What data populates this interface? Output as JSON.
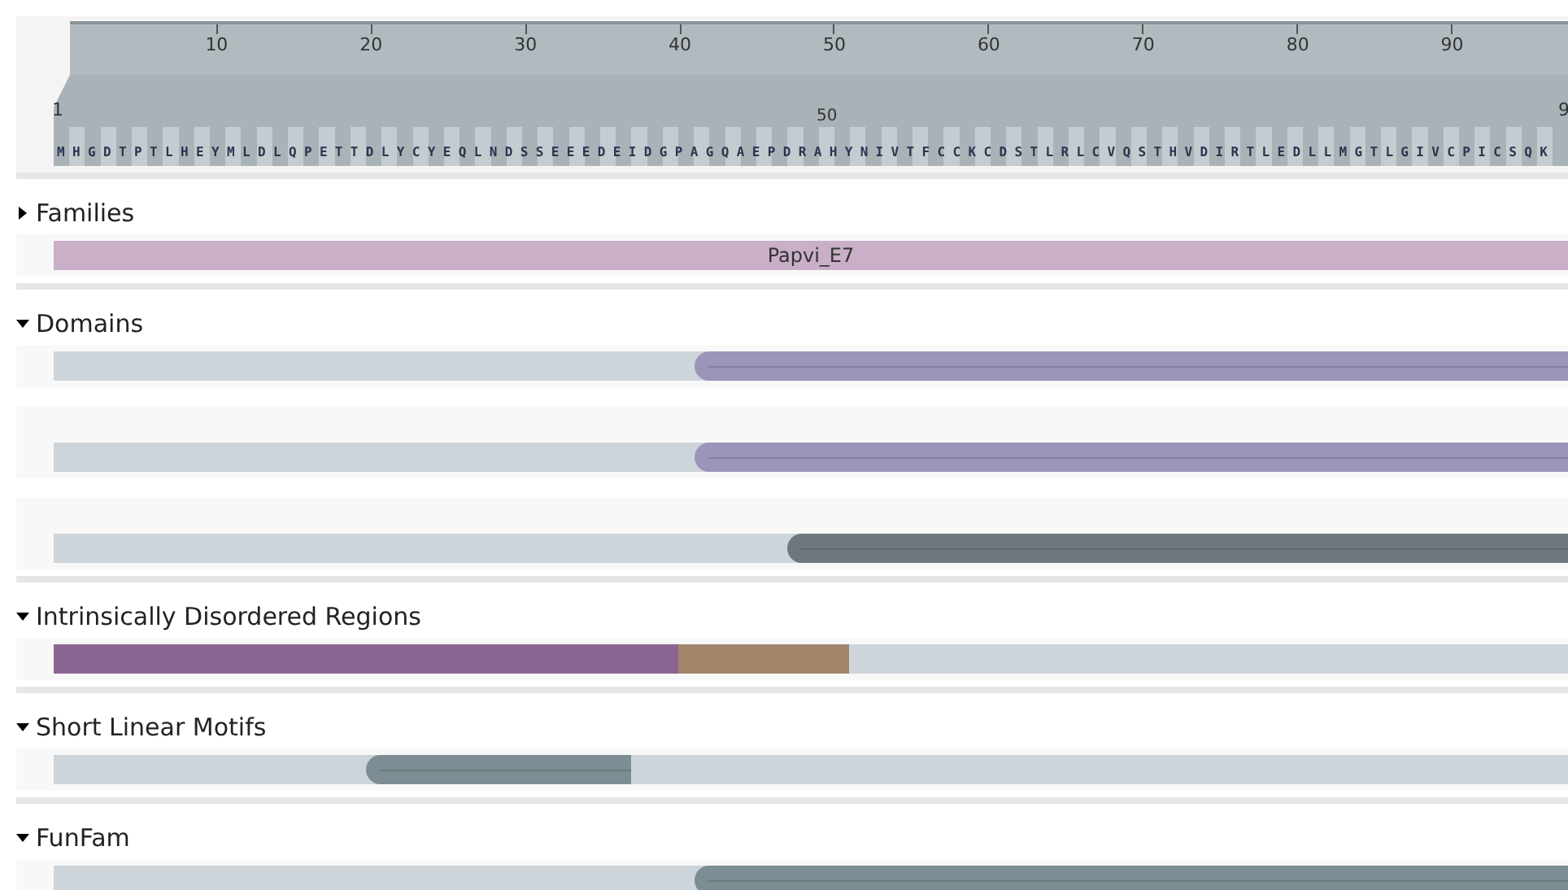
{
  "ruler": {
    "ticks": [
      "10",
      "20",
      "30",
      "40",
      "50",
      "60",
      "70",
      "80",
      "90"
    ],
    "start_label": "1",
    "end_label": "9",
    "marker_label": "50"
  },
  "sequence": "MHGDTPTLHEYMLDLQPETTDLYCYEQLNDSSEEEDEIDGPAGQAEPDRAHYNIVTFCCKCDSTLRLCVQSTHVDIRTLEDLLMGTLGIVCPICSQK",
  "sections": [
    {
      "title": "Families",
      "expanded": false,
      "rows": [
        {
          "features": [
            {
              "kind": "block",
              "color": "#c9afc8",
              "label": "Papvi_E7"
            }
          ]
        }
      ]
    },
    {
      "title": "Domains",
      "expanded": true,
      "rows": [
        {
          "features": [
            {
              "kind": "pill",
              "color": "#9c94b9"
            }
          ]
        },
        {
          "features": [
            {
              "kind": "pill",
              "color": "#9c94b9"
            }
          ]
        },
        {
          "features": [
            {
              "kind": "pill",
              "color": "#6e777c"
            }
          ]
        }
      ]
    },
    {
      "title": "Intrinsically Disordered Regions",
      "expanded": true,
      "rows": [
        {
          "features": [
            {
              "kind": "block",
              "color": "#8b6592"
            },
            {
              "kind": "block",
              "color": "#a3876d"
            }
          ]
        }
      ]
    },
    {
      "title": "Short Linear Motifs",
      "expanded": true,
      "rows": [
        {
          "features": [
            {
              "kind": "pill",
              "color": "#7d8d94"
            }
          ]
        }
      ]
    },
    {
      "title": "FunFam",
      "expanded": true,
      "rows": [
        {
          "features": [
            {
              "kind": "pill",
              "color": "#7d8d94"
            }
          ]
        }
      ]
    }
  ]
}
